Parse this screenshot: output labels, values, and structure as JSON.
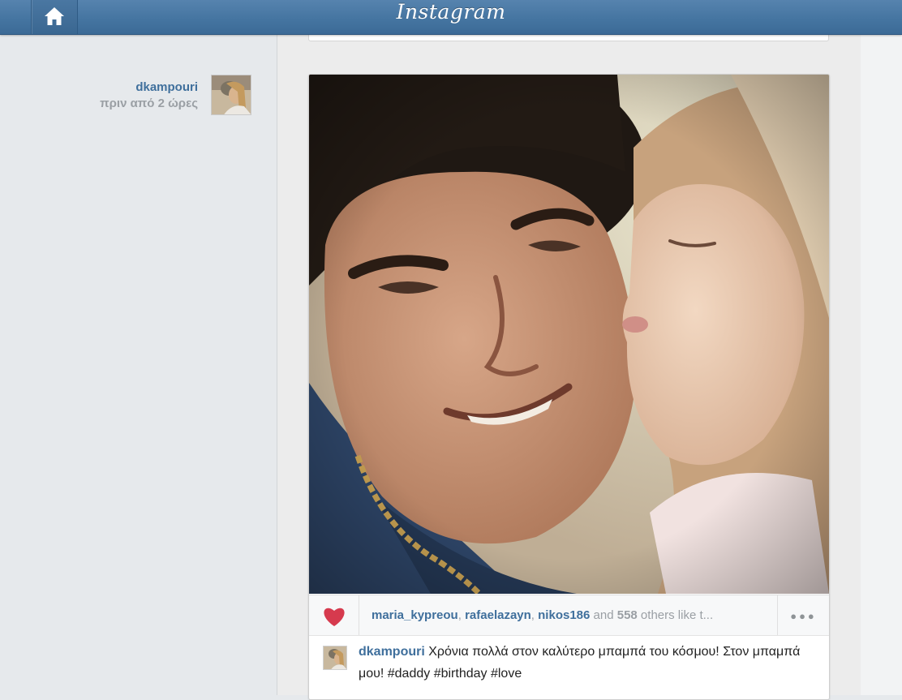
{
  "header": {
    "logo": "Instagram",
    "home_icon": "home-icon"
  },
  "post": {
    "author": "dkampouri",
    "time_ago": "πριν από 2 ώρες",
    "likes": {
      "users": [
        "maria_kypreou",
        "rafaelazayn",
        "nikos186"
      ],
      "sep1": ", ",
      "sep2": ", ",
      "and_text": " and ",
      "count": "558",
      "suffix": " others like t..."
    },
    "more_label": "●●●",
    "caption_user": "dkampouri",
    "caption_text": "Χρόνια πολλά στον καλύτερο μπαμπά του κόσμου! Στον μπαμπά μου! #daddy #birthday #love"
  },
  "colors": {
    "topbar": "#4474a0",
    "link": "#3f6f9c",
    "heart": "#d63a4e",
    "muted": "#9a9fa4"
  }
}
